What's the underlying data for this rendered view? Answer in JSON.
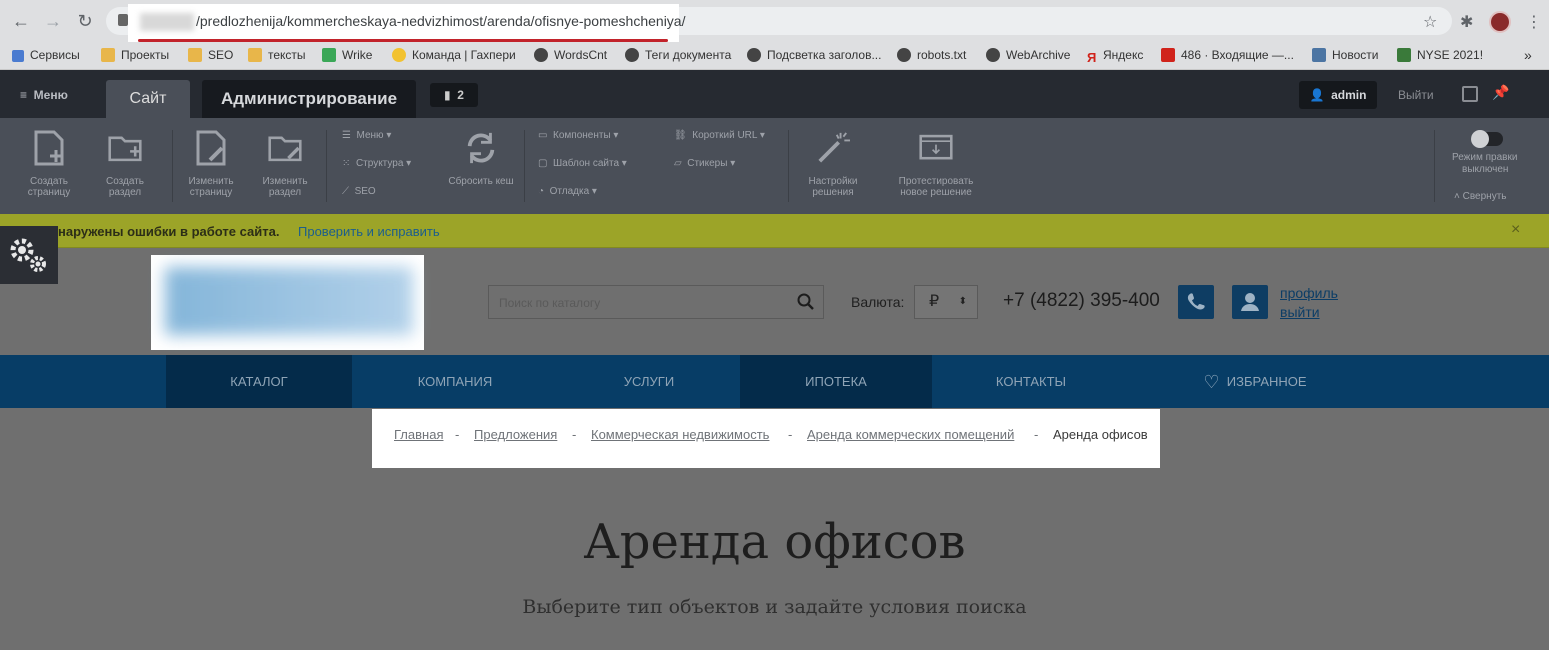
{
  "browser": {
    "url": "/predlozhenija/kommercheskaya-nedvizhimost/arenda/ofisnye-pomeshcheniya/",
    "bookmarks": [
      "Сервисы",
      "Проекты",
      "SEO",
      "тексты",
      "Wrike",
      "Команда | Гахпери",
      "WordsCnt",
      "Теги документа",
      "Подсветка заголов...",
      "robots.txt",
      "WebArchive",
      "Яндекс",
      "486 · Входящие —...",
      "Новости",
      "NYSE 2021!"
    ]
  },
  "admin": {
    "menu": "Меню",
    "tab_site": "Сайт",
    "tab_admin": "Администрирование",
    "notifications": "2",
    "user": "admin",
    "logout": "Выйти",
    "tools": {
      "create_page": "Создать страницу",
      "create_section": "Создать раздел",
      "edit_page": "Изменить страницу",
      "edit_section": "Изменить раздел",
      "menu": "Меню",
      "structure": "Структура",
      "seo": "SEO",
      "reset_cache": "Сбросить кеш",
      "components": "Компоненты",
      "site_template": "Шаблон сайта",
      "debug": "Отладка",
      "short_url": "Короткий URL",
      "stickers": "Стикеры",
      "solution_settings": "Настройки решения",
      "test_solution": "Протестировать новое решение",
      "edit_mode": "Режим правки",
      "edit_mode_state": "выключен",
      "collapse": "Свернуть"
    }
  },
  "error_bar": {
    "text": "наружены ошибки в работе сайта.",
    "link": "Проверить и исправить",
    "close": "×"
  },
  "header": {
    "search_placeholder": "Поиск по каталогу",
    "currency_label": "Валюта:",
    "currency_value": "₽",
    "phone": "+7 (4822) 395-400",
    "profile": "профиль",
    "logout": "выйти"
  },
  "nav": [
    "Каталог",
    "Компания",
    "Услуги",
    "Ипотека",
    "Контакты",
    "Избранное"
  ],
  "breadcrumb": {
    "items": [
      "Главная",
      "Предложения",
      "Коммерческая недвижимость",
      "Аренда коммерческих помещений"
    ],
    "separator": "-",
    "current": "Аренда офисов"
  },
  "page": {
    "title": "Аренда офисов",
    "subtitle": "Выберите тип объектов и задайте условия поиска"
  },
  "colors": {
    "accent": "#073d66",
    "error_bar": "#9ca428",
    "admin_dark": "#262a31"
  }
}
